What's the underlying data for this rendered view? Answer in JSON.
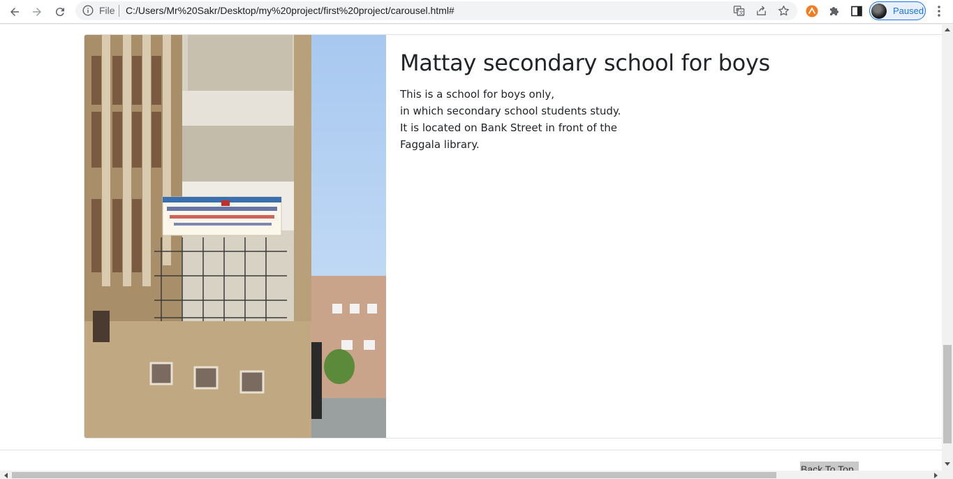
{
  "browser": {
    "address": {
      "scheme_label": "File",
      "url": "C:/Users/Mr%20Sakr/Desktop/my%20project/first%20project/carousel.html#"
    },
    "profile": {
      "label": "Paused"
    },
    "icons": [
      "back-icon",
      "forward-icon",
      "reload-icon",
      "info-icon",
      "translate-icon",
      "share-icon",
      "star-icon",
      "extension-orange-icon",
      "puzzle-icon",
      "side-panel-icon",
      "kebab-menu-icon"
    ]
  },
  "card": {
    "image_alt": "Mattay secondary school building",
    "title": "Mattay secondary school for boys",
    "text_lines": [
      "This is a school for boys only,",
      "in which secondary school students study.",
      "It is located on Bank Street in front of the",
      "Faggala library."
    ]
  },
  "footer": {
    "back_to_top": "Back To Top"
  },
  "colors": {
    "accent": "#1a73e8",
    "text": "#212529",
    "border": "#dee2e6"
  }
}
